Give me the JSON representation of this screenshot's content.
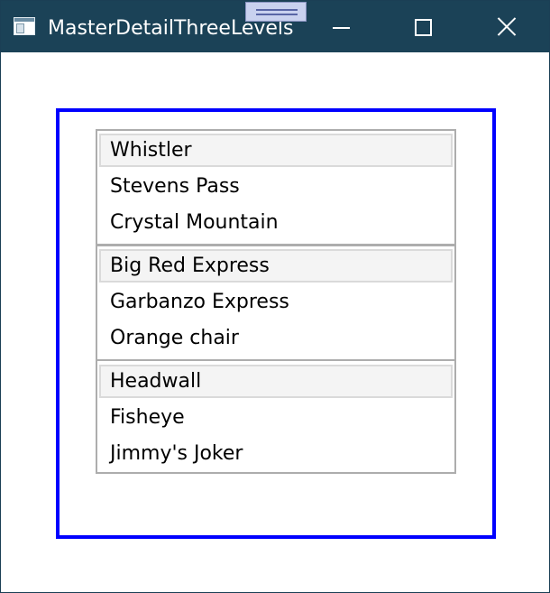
{
  "window": {
    "title": "MasterDetailThreeLevels",
    "icon": "app-window-icon",
    "controls": {
      "minimize": "minimize-icon",
      "maximize": "maximize-icon",
      "close": "close-icon"
    }
  },
  "lists": [
    {
      "items": [
        "Whistler",
        "Stevens Pass",
        "Crystal Mountain"
      ],
      "selected": "Whistler"
    },
    {
      "items": [
        "Big Red Express",
        "Garbanzo Express",
        "Orange chair"
      ],
      "selected": "Big Red Express"
    },
    {
      "items": [
        "Headwall",
        "Fisheye",
        "Jimmy's Joker"
      ],
      "selected": "Headwall"
    }
  ],
  "colors": {
    "titlebar": "#1b4257",
    "content_border": "#0000ff",
    "listbox_border": "#adadad",
    "selected_item": "#f4f4f4"
  }
}
